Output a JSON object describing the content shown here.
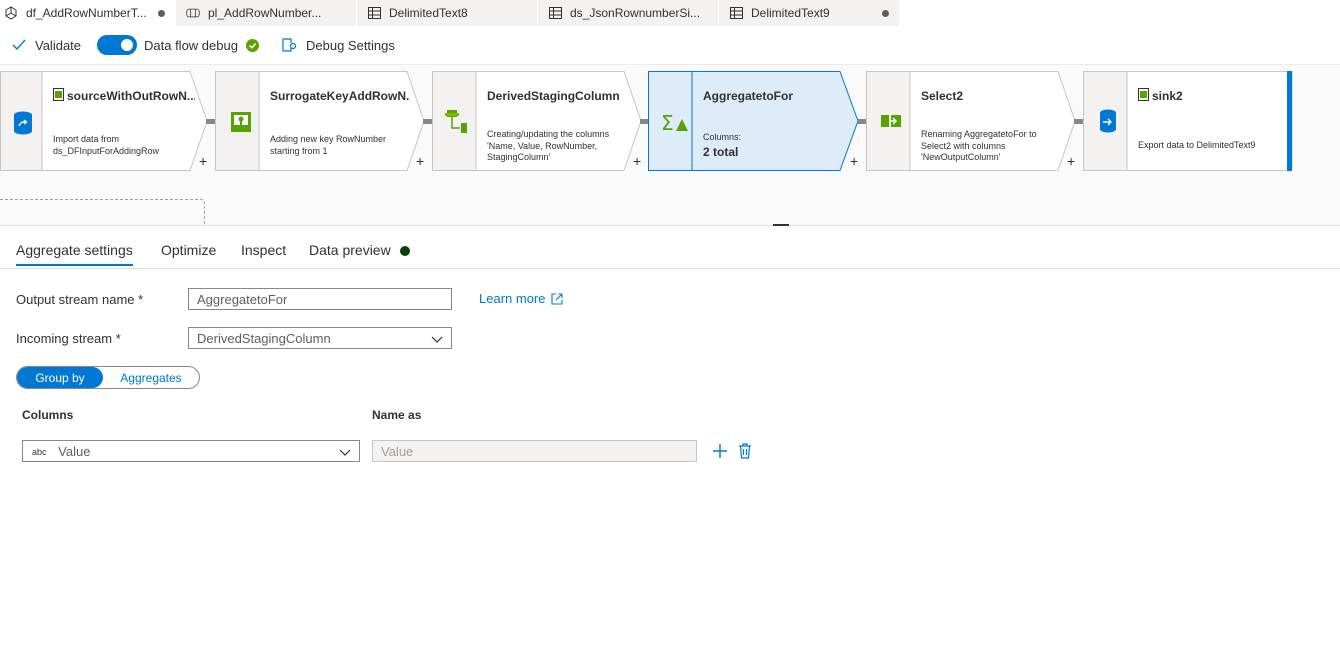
{
  "tabs": [
    {
      "label": "df_AddRowNumberT...",
      "icon": "dataflow-icon",
      "modified": true
    },
    {
      "label": "pl_AddRowNumber...",
      "icon": "pipeline-icon",
      "modified": false
    },
    {
      "label": "DelimitedText8",
      "icon": "table-icon",
      "modified": false
    },
    {
      "label": "ds_JsonRownumberSi...",
      "icon": "table-icon",
      "modified": false
    },
    {
      "label": "DelimitedText9",
      "icon": "table-icon",
      "modified": true
    }
  ],
  "toolbar": {
    "validate_label": "Validate",
    "debug_label": "Data flow debug",
    "debug_settings_label": "Debug Settings"
  },
  "nodes": [
    {
      "title": "sourceWithOutRowN...",
      "desc": [
        "Import data from",
        "ds_DFInputForAddingRow"
      ],
      "icon": "source-icon"
    },
    {
      "title": "SurrogateKeyAddRowN...",
      "desc": [
        "Adding new key RowNumber",
        "starting from 1"
      ],
      "icon": "surrogate-key-icon"
    },
    {
      "title": "DerivedStagingColumn",
      "desc": [
        "Creating/updating the columns",
        "'Name, Value, RowNumber,",
        "StagingColumn'"
      ],
      "icon": "derived-column-icon"
    },
    {
      "title": "AggregatetoFor",
      "cols_label": "Columns:",
      "total": "2 total",
      "icon": "aggregate-icon"
    },
    {
      "title": "Select2",
      "desc": [
        "Renaming AggregatetoFor to",
        "Select2 with columns",
        "'NewOutputColumn'"
      ],
      "icon": "select-icon"
    },
    {
      "title": "sink2",
      "desc": [
        "Export data to DelimitedText9"
      ],
      "icon": "sink-icon"
    }
  ],
  "panel": {
    "tabs": [
      "Aggregate settings",
      "Optimize",
      "Inspect",
      "Data preview"
    ],
    "output_stream_label": "Output stream name *",
    "output_stream_value": "AggregatetoFor",
    "learn_more": "Learn more",
    "incoming_stream_label": "Incoming stream *",
    "incoming_stream_value": "DerivedStagingColumn",
    "group_by_label": "Group by",
    "aggregates_label": "Aggregates",
    "columns_header": "Columns",
    "name_as_header": "Name as",
    "column_type": "abc",
    "column_value": "Value",
    "name_as_value": "Value"
  },
  "colors": {
    "accent": "#0078d4",
    "selected_node": "#deecf9",
    "success": "#57a300"
  }
}
